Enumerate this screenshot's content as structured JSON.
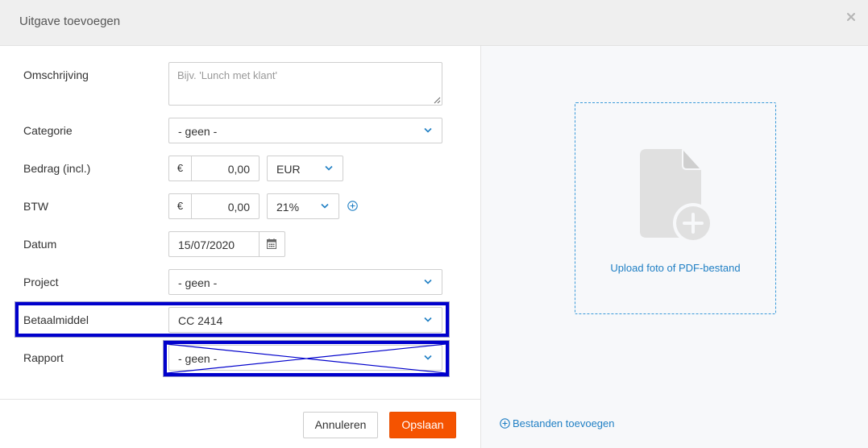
{
  "dialog": {
    "title": "Uitgave toevoegen",
    "close_icon": "close-icon"
  },
  "form": {
    "description": {
      "label": "Omschrijving",
      "value": "",
      "placeholder": "Bijv. 'Lunch met klant'"
    },
    "category": {
      "label": "Categorie",
      "value": "- geen -"
    },
    "amount": {
      "label": "Bedrag (incl.)",
      "currency_symbol": "€",
      "value": "0,00",
      "currency": "EUR"
    },
    "vat": {
      "label": "BTW",
      "currency_symbol": "€",
      "value": "0,00",
      "rate": "21%"
    },
    "date": {
      "label": "Datum",
      "value": "15/07/2020"
    },
    "project": {
      "label": "Project",
      "value": "- geen -"
    },
    "payment_method": {
      "label": "Betaalmiddel",
      "value": "CC 2414"
    },
    "report": {
      "label": "Rapport",
      "value": "- geen -"
    }
  },
  "footer": {
    "cancel_label": "Annuleren",
    "save_label": "Opslaan",
    "add_files_label": "Bestanden toevoegen"
  },
  "upload": {
    "label": "Upload foto of PDF-bestand"
  },
  "colors": {
    "accent_orange": "#f55300",
    "link_blue": "#1f7fc4",
    "annotation_blue": "#0000cc"
  }
}
